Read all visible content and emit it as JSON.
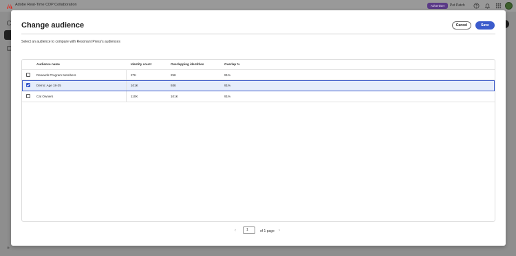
{
  "app": {
    "title": "Adobe Real-Time CDP Collaboration",
    "role_badge": "Advertiser",
    "org_name": "Pet Patch",
    "brand_color": "#e1251b"
  },
  "modal": {
    "title": "Change audience",
    "subtitle": "Select an audience to compare with Resonant Press's audiences",
    "cancel_label": "Cancel",
    "save_label": "Save"
  },
  "table": {
    "headers": {
      "name": "Audience name",
      "identity": "Identity count",
      "overlapping": "Overlapping identities",
      "overlap_pct": "Overlap %"
    },
    "rows": [
      {
        "name": "Rewards Program Members",
        "identity": "27K",
        "overlapping": "25K",
        "overlap_pct": "91%",
        "selected": false
      },
      {
        "name": "Demo: Age 18-25",
        "identity": "101K",
        "overlapping": "93K",
        "overlap_pct": "91%",
        "selected": true
      },
      {
        "name": "Cat Owners",
        "identity": "110K",
        "overlapping": "101K",
        "overlap_pct": "91%",
        "selected": false
      }
    ]
  },
  "pagination": {
    "current_page": "1",
    "of_label": "of 1 page"
  },
  "icons": {
    "app_logo": "adobe-logo-icon",
    "help": "help-icon",
    "notifications": "bell-icon",
    "apps": "grid-apps-icon",
    "prev": "chevron-left-icon",
    "next": "chevron-right-icon",
    "expand_rail": "double-chevron-right-icon"
  }
}
